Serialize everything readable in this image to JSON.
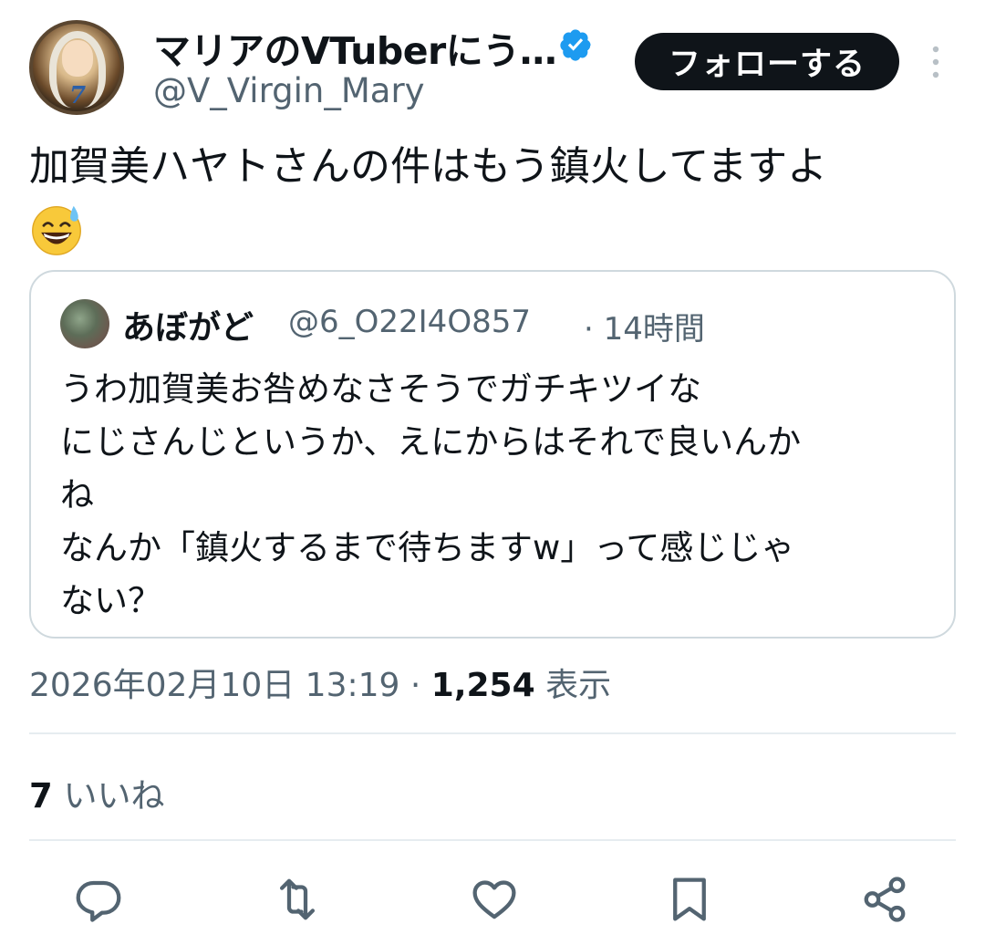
{
  "author": {
    "display_name": "マリアのVTuberにう…",
    "handle": "@V_Virgin_Mary",
    "verified": true
  },
  "follow_button": {
    "label": "フォローする"
  },
  "tweet": {
    "text": "加賀美ハヤトさんの件はもう鎮火してますよ",
    "emoji": "grinning-face-with-sweat-icon"
  },
  "quote": {
    "name": "あぼがど",
    "handle": "@6_O22I4O857",
    "time": "· 14時間",
    "text": "うわ加賀美お咎めなさそうでガチキツイな\nにじさんじというか、えにからはそれで良いんか\nね\nなんか「鎮火するまで待ちますw」って感じじゃ\nない？"
  },
  "meta": {
    "timestamp": "2026年02月10日 13:19 · ",
    "views_count": "1,254",
    "views_label": " 表示"
  },
  "likes": {
    "count": "7",
    "label": " いいね"
  },
  "actions": [
    "reply-icon",
    "retweet-icon",
    "like-icon",
    "bookmark-icon",
    "share-icon"
  ],
  "colors": {
    "text": "#0f1419",
    "secondary": "#536471",
    "verified": "#1d9bf0",
    "border": "#cfd9de"
  }
}
